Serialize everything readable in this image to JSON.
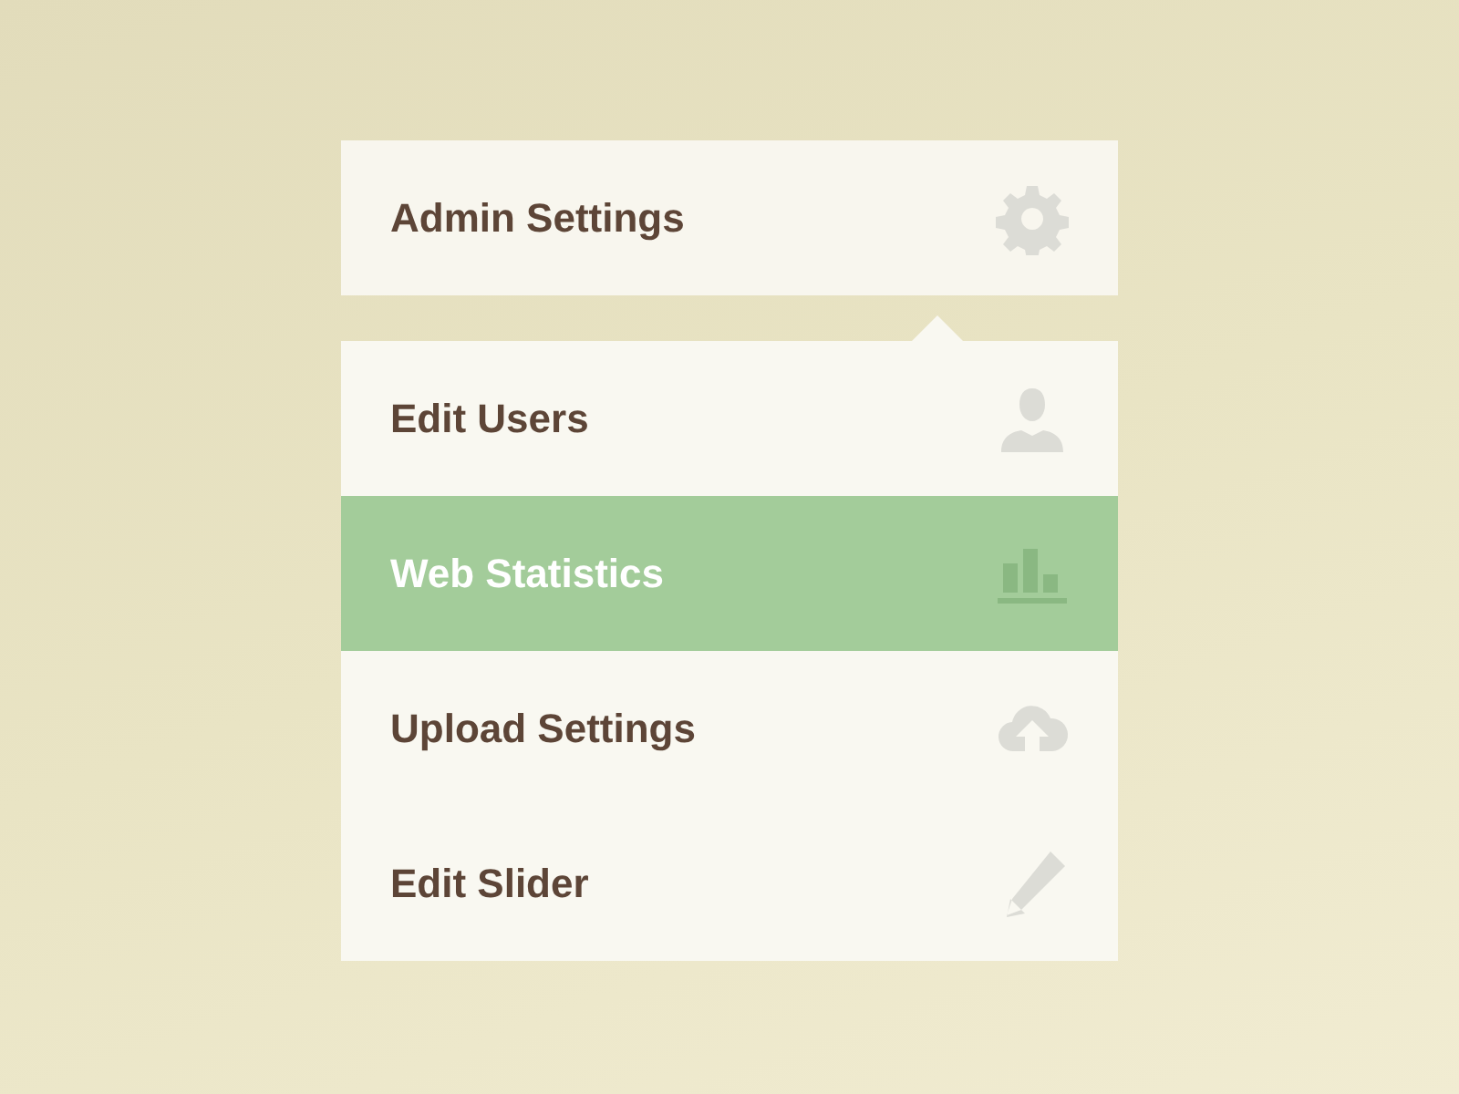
{
  "header": {
    "title": "Admin Settings"
  },
  "menu": [
    {
      "label": "Edit Users",
      "selected": false
    },
    {
      "label": "Web Statistics",
      "selected": true
    },
    {
      "label": "Upload Settings",
      "selected": false
    },
    {
      "label": "Edit Slider",
      "selected": false
    }
  ]
}
